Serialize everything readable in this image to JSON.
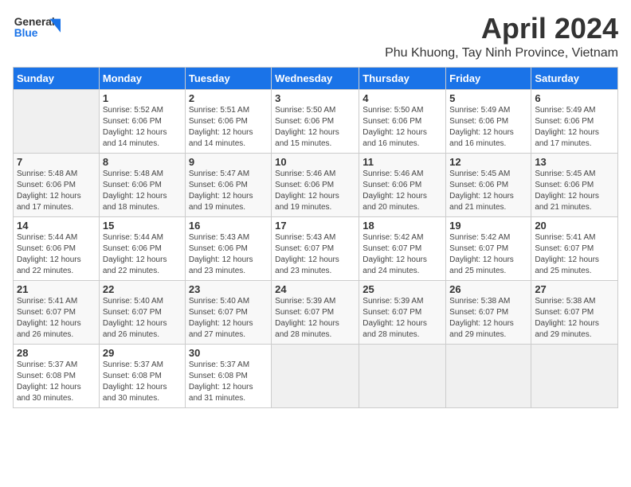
{
  "header": {
    "logo_line1": "General",
    "logo_line2": "Blue",
    "title": "April 2024",
    "subtitle": "Phu Khuong, Tay Ninh Province, Vietnam"
  },
  "days_of_week": [
    "Sunday",
    "Monday",
    "Tuesday",
    "Wednesday",
    "Thursday",
    "Friday",
    "Saturday"
  ],
  "weeks": [
    [
      {
        "num": "",
        "info": ""
      },
      {
        "num": "1",
        "info": "Sunrise: 5:52 AM\nSunset: 6:06 PM\nDaylight: 12 hours\nand 14 minutes."
      },
      {
        "num": "2",
        "info": "Sunrise: 5:51 AM\nSunset: 6:06 PM\nDaylight: 12 hours\nand 14 minutes."
      },
      {
        "num": "3",
        "info": "Sunrise: 5:50 AM\nSunset: 6:06 PM\nDaylight: 12 hours\nand 15 minutes."
      },
      {
        "num": "4",
        "info": "Sunrise: 5:50 AM\nSunset: 6:06 PM\nDaylight: 12 hours\nand 16 minutes."
      },
      {
        "num": "5",
        "info": "Sunrise: 5:49 AM\nSunset: 6:06 PM\nDaylight: 12 hours\nand 16 minutes."
      },
      {
        "num": "6",
        "info": "Sunrise: 5:49 AM\nSunset: 6:06 PM\nDaylight: 12 hours\nand 17 minutes."
      }
    ],
    [
      {
        "num": "7",
        "info": "Sunrise: 5:48 AM\nSunset: 6:06 PM\nDaylight: 12 hours\nand 17 minutes."
      },
      {
        "num": "8",
        "info": "Sunrise: 5:48 AM\nSunset: 6:06 PM\nDaylight: 12 hours\nand 18 minutes."
      },
      {
        "num": "9",
        "info": "Sunrise: 5:47 AM\nSunset: 6:06 PM\nDaylight: 12 hours\nand 19 minutes."
      },
      {
        "num": "10",
        "info": "Sunrise: 5:46 AM\nSunset: 6:06 PM\nDaylight: 12 hours\nand 19 minutes."
      },
      {
        "num": "11",
        "info": "Sunrise: 5:46 AM\nSunset: 6:06 PM\nDaylight: 12 hours\nand 20 minutes."
      },
      {
        "num": "12",
        "info": "Sunrise: 5:45 AM\nSunset: 6:06 PM\nDaylight: 12 hours\nand 21 minutes."
      },
      {
        "num": "13",
        "info": "Sunrise: 5:45 AM\nSunset: 6:06 PM\nDaylight: 12 hours\nand 21 minutes."
      }
    ],
    [
      {
        "num": "14",
        "info": "Sunrise: 5:44 AM\nSunset: 6:06 PM\nDaylight: 12 hours\nand 22 minutes."
      },
      {
        "num": "15",
        "info": "Sunrise: 5:44 AM\nSunset: 6:06 PM\nDaylight: 12 hours\nand 22 minutes."
      },
      {
        "num": "16",
        "info": "Sunrise: 5:43 AM\nSunset: 6:06 PM\nDaylight: 12 hours\nand 23 minutes."
      },
      {
        "num": "17",
        "info": "Sunrise: 5:43 AM\nSunset: 6:07 PM\nDaylight: 12 hours\nand 23 minutes."
      },
      {
        "num": "18",
        "info": "Sunrise: 5:42 AM\nSunset: 6:07 PM\nDaylight: 12 hours\nand 24 minutes."
      },
      {
        "num": "19",
        "info": "Sunrise: 5:42 AM\nSunset: 6:07 PM\nDaylight: 12 hours\nand 25 minutes."
      },
      {
        "num": "20",
        "info": "Sunrise: 5:41 AM\nSunset: 6:07 PM\nDaylight: 12 hours\nand 25 minutes."
      }
    ],
    [
      {
        "num": "21",
        "info": "Sunrise: 5:41 AM\nSunset: 6:07 PM\nDaylight: 12 hours\nand 26 minutes."
      },
      {
        "num": "22",
        "info": "Sunrise: 5:40 AM\nSunset: 6:07 PM\nDaylight: 12 hours\nand 26 minutes."
      },
      {
        "num": "23",
        "info": "Sunrise: 5:40 AM\nSunset: 6:07 PM\nDaylight: 12 hours\nand 27 minutes."
      },
      {
        "num": "24",
        "info": "Sunrise: 5:39 AM\nSunset: 6:07 PM\nDaylight: 12 hours\nand 28 minutes."
      },
      {
        "num": "25",
        "info": "Sunrise: 5:39 AM\nSunset: 6:07 PM\nDaylight: 12 hours\nand 28 minutes."
      },
      {
        "num": "26",
        "info": "Sunrise: 5:38 AM\nSunset: 6:07 PM\nDaylight: 12 hours\nand 29 minutes."
      },
      {
        "num": "27",
        "info": "Sunrise: 5:38 AM\nSunset: 6:07 PM\nDaylight: 12 hours\nand 29 minutes."
      }
    ],
    [
      {
        "num": "28",
        "info": "Sunrise: 5:37 AM\nSunset: 6:08 PM\nDaylight: 12 hours\nand 30 minutes."
      },
      {
        "num": "29",
        "info": "Sunrise: 5:37 AM\nSunset: 6:08 PM\nDaylight: 12 hours\nand 30 minutes."
      },
      {
        "num": "30",
        "info": "Sunrise: 5:37 AM\nSunset: 6:08 PM\nDaylight: 12 hours\nand 31 minutes."
      },
      {
        "num": "",
        "info": ""
      },
      {
        "num": "",
        "info": ""
      },
      {
        "num": "",
        "info": ""
      },
      {
        "num": "",
        "info": ""
      }
    ]
  ]
}
